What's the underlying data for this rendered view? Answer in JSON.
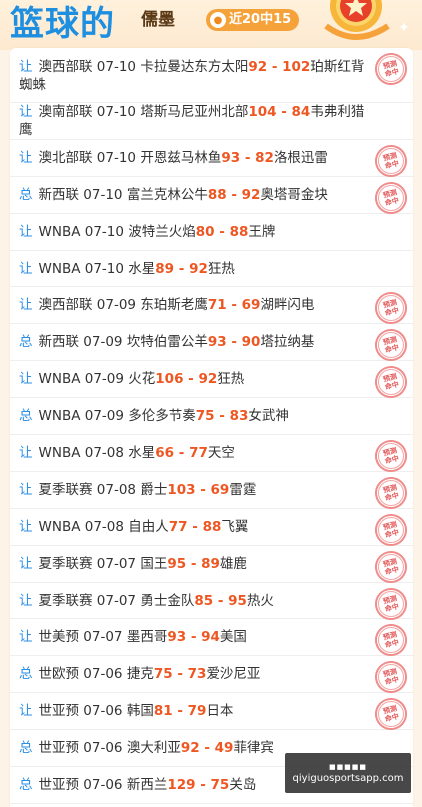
{
  "header": {
    "title": "篮球的",
    "author": "儒墨",
    "streak": "近20中15"
  },
  "stamp": {
    "line1": "预测",
    "line2": "命中"
  },
  "watermark": {
    "top": "■■■■■",
    "bottom": "qiyiguosportsapp.com"
  },
  "rows": [
    {
      "type": "让",
      "league": "澳西部联",
      "date": "07-10",
      "home": "卡拉曼达东方太阳",
      "hs": "92",
      "sep": " - ",
      "as": "102",
      "away": "珀斯红背蜘蛛",
      "hit": true,
      "layout": "double"
    },
    {
      "type": "让",
      "league": "澳南部联",
      "date": "07-10",
      "home": "塔斯马尼亚州北部",
      "hs": "104",
      "sep": " - ",
      "as": "84",
      "away": "韦弗利猎鹰",
      "hit": false,
      "layout": "single"
    },
    {
      "type": "让",
      "league": "澳北部联",
      "date": "07-10",
      "home": "开恩兹马林鱼",
      "hs": "93",
      "sep": " - ",
      "as": "82",
      "away": "洛根迅雷",
      "hit": true,
      "layout": "single"
    },
    {
      "type": "总",
      "league": "新西联",
      "date": "07-10",
      "home": "富兰克林公牛",
      "hs": "88",
      "sep": " - ",
      "as": "92",
      "away": "奥塔哥金块",
      "hit": true,
      "layout": "single"
    },
    {
      "type": "让",
      "league": "WNBA",
      "date": "07-10",
      "home": "波特兰火焰",
      "hs": "80",
      "sep": " - ",
      "as": "88",
      "away": "王牌",
      "hit": false,
      "layout": "single"
    },
    {
      "type": "让",
      "league": "WNBA",
      "date": "07-10",
      "home": "水星",
      "hs": "89",
      "sep": " - ",
      "as": "92",
      "away": "狂热",
      "hit": false,
      "layout": "single"
    },
    {
      "type": "让",
      "league": "澳西部联",
      "date": "07-09",
      "home": "东珀斯老鹰",
      "hs": "71",
      "sep": " - ",
      "as": "69",
      "away": "湖畔闪电",
      "hit": true,
      "layout": "single"
    },
    {
      "type": "总",
      "league": "新西联",
      "date": "07-09",
      "home": "坎特伯雷公羊",
      "hs": "93",
      "sep": " - ",
      "as": "90",
      "away": "塔拉纳基",
      "hit": true,
      "layout": "single"
    },
    {
      "type": "让",
      "league": "WNBA",
      "date": "07-09",
      "home": "火花",
      "hs": "106",
      "sep": " - ",
      "as": "92",
      "away": "狂热",
      "hit": true,
      "layout": "single"
    },
    {
      "type": "总",
      "league": "WNBA",
      "date": "07-09",
      "home": "多伦多节奏",
      "hs": "75",
      "sep": " - ",
      "as": "83",
      "away": "女武神",
      "hit": false,
      "layout": "single"
    },
    {
      "type": "让",
      "league": "WNBA",
      "date": "07-08",
      "home": "水星",
      "hs": "66",
      "sep": " - ",
      "as": "77",
      "away": "天空",
      "hit": true,
      "layout": "single"
    },
    {
      "type": "让",
      "league": "夏季联赛",
      "date": "07-08",
      "home": "爵士",
      "hs": "103",
      "sep": " - ",
      "as": "69",
      "away": "雷霆",
      "hit": true,
      "layout": "single"
    },
    {
      "type": "让",
      "league": "WNBA",
      "date": "07-08",
      "home": "自由人",
      "hs": "77",
      "sep": " - ",
      "as": "88",
      "away": "飞翼",
      "hit": true,
      "layout": "single"
    },
    {
      "type": "让",
      "league": "夏季联赛",
      "date": "07-07",
      "home": "国王",
      "hs": "95",
      "sep": " - ",
      "as": "89",
      "away": "雄鹿",
      "hit": true,
      "layout": "single"
    },
    {
      "type": "让",
      "league": "夏季联赛",
      "date": "07-07",
      "home": "勇士金队",
      "hs": "85",
      "sep": " - ",
      "as": "95",
      "away": "热火",
      "hit": true,
      "layout": "single"
    },
    {
      "type": "让",
      "league": "世美预",
      "date": "07-07",
      "home": "墨西哥",
      "hs": "93",
      "sep": " - ",
      "as": "94",
      "away": "美国",
      "hit": true,
      "layout": "single"
    },
    {
      "type": "总",
      "league": "世欧预",
      "date": "07-06",
      "home": "捷克",
      "hs": "75",
      "sep": " - ",
      "as": "73",
      "away": "爱沙尼亚",
      "hit": true,
      "layout": "single"
    },
    {
      "type": "让",
      "league": "世亚预",
      "date": "07-06",
      "home": "韩国",
      "hs": "81",
      "sep": " - ",
      "as": "79",
      "away": "日本",
      "hit": true,
      "layout": "single"
    },
    {
      "type": "总",
      "league": "世亚预",
      "date": "07-06",
      "home": "澳大利亚",
      "hs": "92",
      "sep": " - ",
      "as": "49",
      "away": "菲律宾",
      "hit": false,
      "layout": "single"
    },
    {
      "type": "总",
      "league": "世亚预",
      "date": "07-06",
      "home": "新西兰",
      "hs": "129",
      "sep": " - ",
      "as": "75",
      "away": "关岛",
      "hit": false,
      "layout": "single"
    }
  ]
}
